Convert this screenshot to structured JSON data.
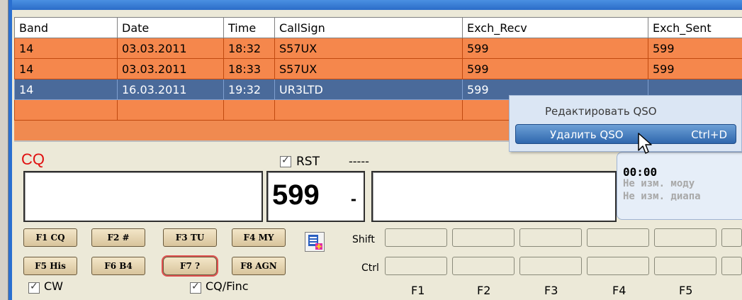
{
  "grid": {
    "columns": [
      "Band",
      "Date",
      "Time",
      "CallSign",
      "Exch_Recv",
      "Exch_Sent"
    ],
    "rows": [
      {
        "band": "14",
        "date": "03.03.2011",
        "time": "18:32",
        "call": "S57UX",
        "recv": "599",
        "sent": "599"
      },
      {
        "band": "14",
        "date": "03.03.2011",
        "time": "18:33",
        "call": "S57UX",
        "recv": "599",
        "sent": "599"
      },
      {
        "band": "14",
        "date": "16.03.2011",
        "time": "19:32",
        "call": "UR3LTD",
        "recv": "599",
        "sent": ""
      }
    ]
  },
  "context_menu": {
    "edit_label": "Редактировать QSO",
    "delete_label": "Удалить QSO",
    "delete_shortcut": "Ctrl+D"
  },
  "entry": {
    "cq_label": "CQ",
    "rst_label": "RST",
    "rst_value": "-----",
    "call_value": "",
    "rst_field_value": "599",
    "rst_dropdown": "-",
    "exch_value": ""
  },
  "info": {
    "time": "00:00",
    "line1": "Не изм. моду",
    "line2": "Не изм. диапа"
  },
  "fkeys": {
    "f1": "F1 CQ",
    "f2": "F2 #",
    "f3": "F3 TU",
    "f4": "F4 MY",
    "f5": "F5 His",
    "f6": "F6 B4",
    "f7": "F7 ?",
    "f8": "F8 AGN"
  },
  "macro": {
    "shift_label": "Shift",
    "ctrl_label": "Ctrl",
    "keys": [
      "F1",
      "F2",
      "F3",
      "F4",
      "F5"
    ]
  },
  "options": {
    "cw_label": "CW",
    "cqfinc_label": "CQ/Finc"
  },
  "colors": {
    "grid_row": "#f5874c",
    "grid_selected": "#4a6a9a",
    "cq_red": "#e01010",
    "menu_highlight": "#2f67ad"
  }
}
